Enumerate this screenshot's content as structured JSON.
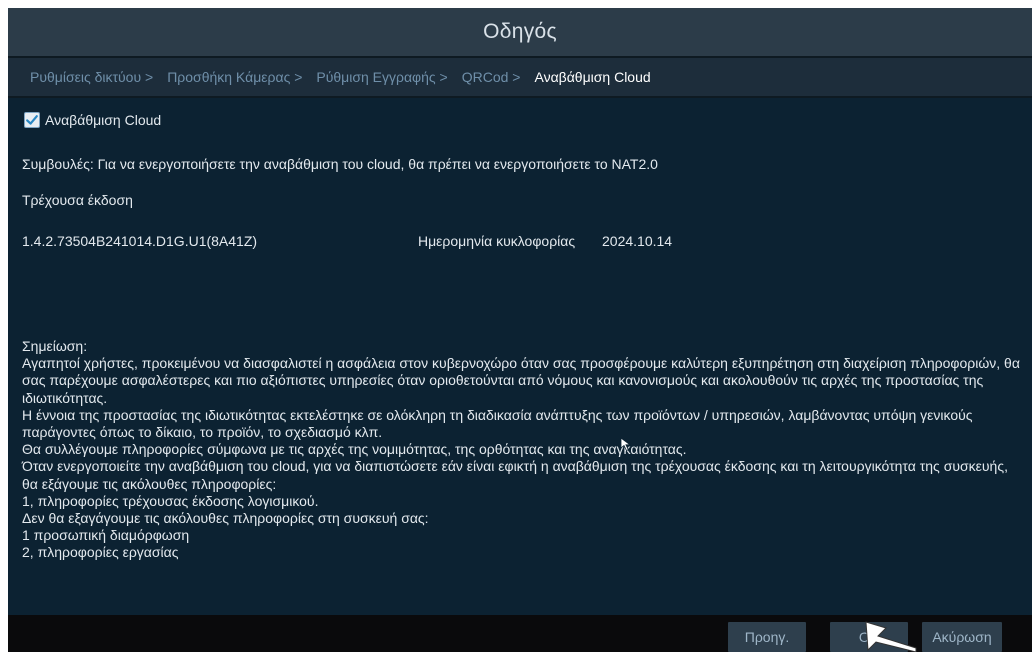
{
  "window": {
    "title": "Οδηγός"
  },
  "steps": [
    {
      "label": "Ρυθμίσεις δικτύου >"
    },
    {
      "label": "Προσθήκη Κάμερας >"
    },
    {
      "label": "Ρύθμιση Εγγραφής >"
    },
    {
      "label": "QRCod >"
    },
    {
      "label": "Αναβάθμιση Cloud"
    }
  ],
  "cloud_upgrade": {
    "checkbox_label": "Αναβάθμιση Cloud",
    "checked": true,
    "tips": "Συμβουλές: Για να ενεργοποιήσετε την αναβάθμιση του cloud, θα πρέπει να ενεργοποιήσετε το NAT2.0",
    "current_version_label": "Τρέχουσα έκδοση",
    "version": "1.4.2.73504B241014.D1G.U1(8A41Z)",
    "release_date_label": "Ημερομηνία κυκλοφορίας",
    "release_date": "2024.10.14"
  },
  "note": {
    "heading": "Σημείωση:",
    "lines": [
      "Αγαπητοί χρήστες, προκειμένου να διασφαλιστεί η ασφάλεια στον κυβερνοχώρο όταν σας προσφέρουμε καλύτερη εξυπηρέτηση στη διαχείριση πληροφοριών, θα σας παρέχουμε ασφαλέστερες και πιο αξιόπιστες υπηρεσίες όταν οριοθετούνται από νόμους και κανονισμούς και ακολουθούν τις αρχές της προστασίας της ιδιωτικότητας.",
      " Η έννοια της προστασίας της ιδιωτικότητας εκτελέστηκε σε ολόκληρη τη διαδικασία ανάπτυξης των προϊόντων / υπηρεσιών, λαμβάνοντας υπόψη γενικούς παράγοντες όπως το δίκαιο, το προϊόν, το σχεδιασμό κλπ.",
      " Θα συλλέγουμε πληροφορίες σύμφωνα με τις αρχές της νομιμότητας, της ορθότητας και της αναγκαιότητας.",
      " Όταν ενεργοποιείτε την αναβάθμιση του cloud, για να διαπιστώσετε εάν είναι εφικτή η αναβάθμιση της τρέχουσας έκδοσης και τη λειτουργικότητα της συσκευής, θα εξάγουμε τις ακόλουθες πληροφορίες:",
      " 1, πληροφορίες τρέχουσας έκδοσης λογισμικού.",
      " Δεν θα εξαγάγουμε τις ακόλουθες πληροφορίες στη συσκευή σας:",
      " 1 προσωπική διαμόρφωση",
      " 2, πληροφορίες εργασίας"
    ]
  },
  "footer": {
    "prev_label": "Προηγ.",
    "ok_label": "OK",
    "cancel_label": "Ακύρωση"
  },
  "colors": {
    "titlebar": "#2c3c49",
    "steps_bar": "#1d2d3b",
    "content_bg": "#0c2232",
    "footer_bg": "#0a0a0c",
    "button_bg": "#2e3f4d",
    "step_inactive": "#6f8fa9",
    "step_active": "#ffffff"
  },
  "icons": {
    "checkbox": "check-icon",
    "pointer": "mouse-pointer-icon"
  }
}
